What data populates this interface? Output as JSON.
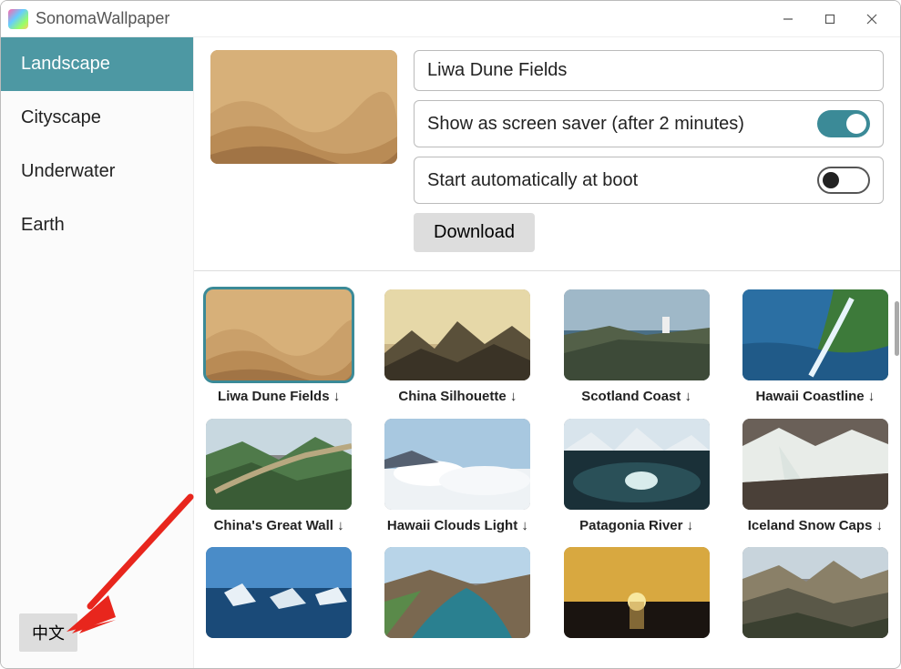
{
  "window": {
    "title": "SonomaWallpaper"
  },
  "sidebar": {
    "items": [
      {
        "label": "Landscape",
        "active": true
      },
      {
        "label": "Cityscape"
      },
      {
        "label": "Underwater"
      },
      {
        "label": "Earth"
      }
    ],
    "lang_button": "中文"
  },
  "settings": {
    "name_value": "Liwa Dune Fields",
    "screensaver_label": "Show as screen saver (after 2 minutes)",
    "screensaver_on": true,
    "boot_label": "Start automatically at boot",
    "boot_on": false,
    "download_label": "Download"
  },
  "wallpapers": [
    {
      "label": "Liwa Dune Fields ↓",
      "selected": true,
      "thumb": "dunes"
    },
    {
      "label": "China Silhouette ↓",
      "thumb": "silhouette"
    },
    {
      "label": "Scotland Coast ↓",
      "thumb": "scotland"
    },
    {
      "label": "Hawaii Coastline ↓",
      "thumb": "hawaii"
    },
    {
      "label": "China's Great Wall ↓",
      "thumb": "wall"
    },
    {
      "label": "Hawaii Clouds Light ↓",
      "thumb": "clouds"
    },
    {
      "label": "Patagonia River ↓",
      "thumb": "patagonia"
    },
    {
      "label": "Iceland Snow Caps ↓",
      "thumb": "iceland"
    },
    {
      "label": "",
      "thumb": "ice"
    },
    {
      "label": "",
      "thumb": "river"
    },
    {
      "label": "",
      "thumb": "sunset"
    },
    {
      "label": "",
      "thumb": "canyon"
    }
  ]
}
